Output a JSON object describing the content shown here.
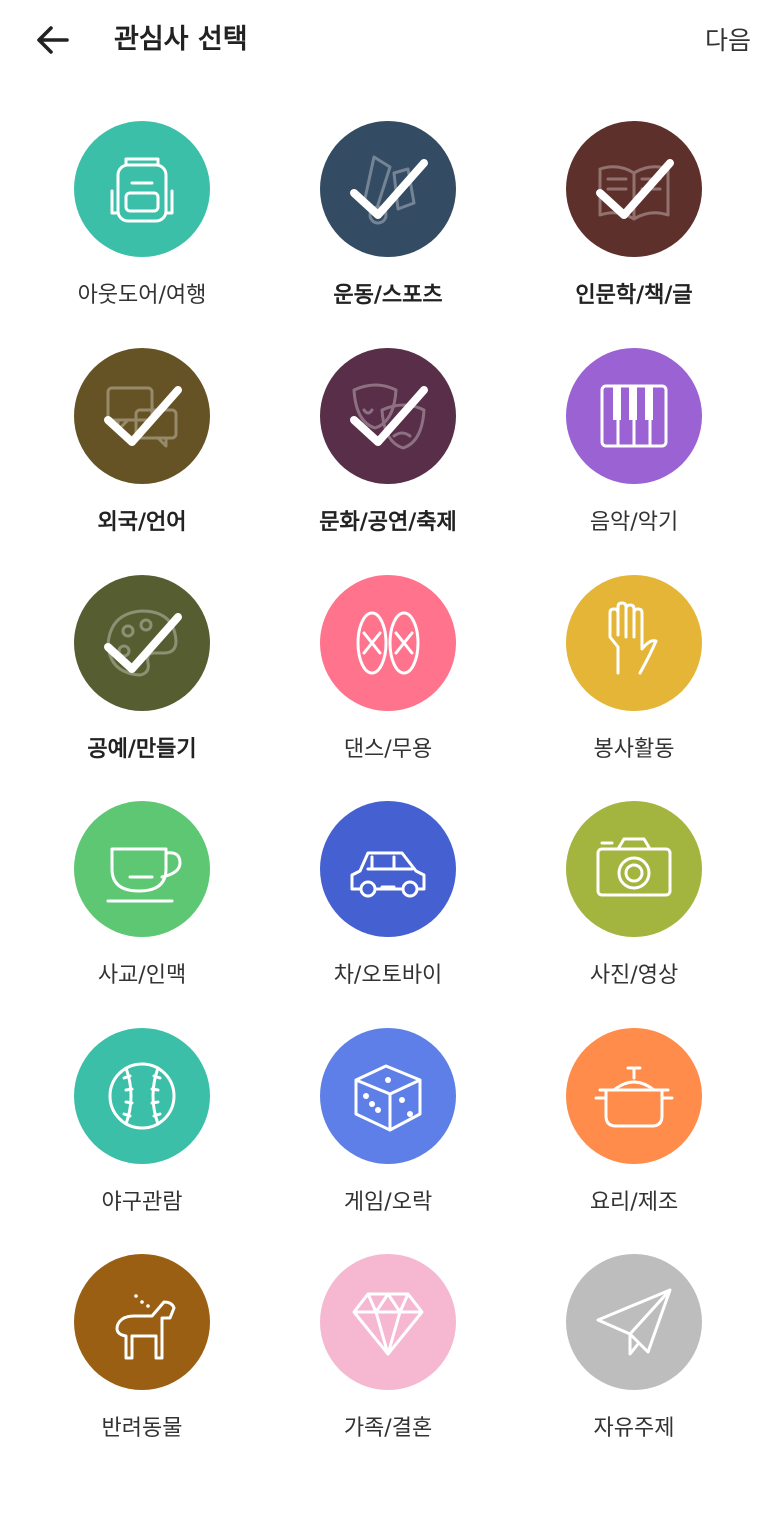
{
  "header": {
    "title": "관심사 선택",
    "next_label": "다음"
  },
  "interests": [
    {
      "label": "아웃도어/여행",
      "color": "#3cbfa8",
      "icon": "backpack-icon",
      "selected": false
    },
    {
      "label": "운동/스포츠",
      "color": "#334b63",
      "icon": "shuttlecock-icon",
      "selected": true
    },
    {
      "label": "인문학/책/글",
      "color": "#5e302b",
      "icon": "book-icon",
      "selected": true
    },
    {
      "label": "외국/언어",
      "color": "#655326",
      "icon": "speech-bubbles-icon",
      "selected": true
    },
    {
      "label": "문화/공연/축제",
      "color": "#582e49",
      "icon": "theater-masks-icon",
      "selected": true
    },
    {
      "label": "음악/악기",
      "color": "#9b62d4",
      "icon": "piano-keys-icon",
      "selected": false
    },
    {
      "label": "공예/만들기",
      "color": "#555d31",
      "icon": "palette-icon",
      "selected": true
    },
    {
      "label": "댄스/무용",
      "color": "#ff738c",
      "icon": "ballet-shoes-icon",
      "selected": false
    },
    {
      "label": "봉사활동",
      "color": "#e4b537",
      "icon": "hand-icon",
      "selected": false
    },
    {
      "label": "사교/인맥",
      "color": "#5ec773",
      "icon": "coffee-cup-icon",
      "selected": false
    },
    {
      "label": "차/오토바이",
      "color": "#4560d1",
      "icon": "car-icon",
      "selected": false
    },
    {
      "label": "사진/영상",
      "color": "#a3b53e",
      "icon": "camera-icon",
      "selected": false
    },
    {
      "label": "야구관람",
      "color": "#3cbfa8",
      "icon": "baseball-icon",
      "selected": false
    },
    {
      "label": "게임/오락",
      "color": "#5e7fe8",
      "icon": "dice-icon",
      "selected": false
    },
    {
      "label": "요리/제조",
      "color": "#ff8c4b",
      "icon": "pot-icon",
      "selected": false
    },
    {
      "label": "반려동물",
      "color": "#9a5f12",
      "icon": "dog-icon",
      "selected": false
    },
    {
      "label": "가족/결혼",
      "color": "#f5b8d0",
      "icon": "diamond-icon",
      "selected": false
    },
    {
      "label": "자유주제",
      "color": "#bdbdbd",
      "icon": "paper-plane-icon",
      "selected": false
    }
  ]
}
